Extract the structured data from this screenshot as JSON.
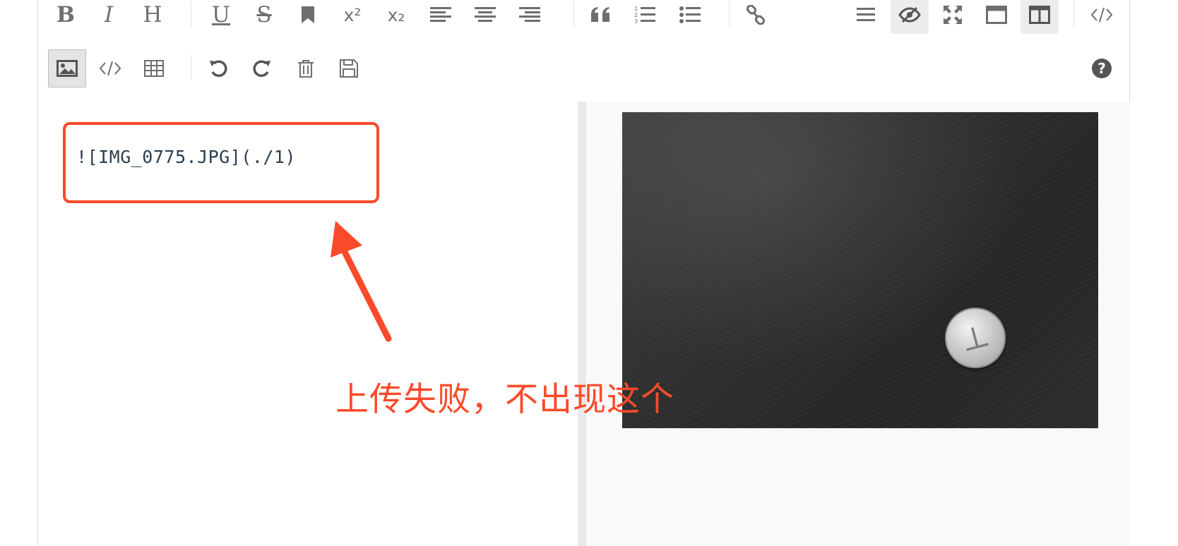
{
  "toolbar": {
    "bold": "B",
    "italic": "I",
    "heading": "H",
    "underline": "U",
    "strike": "S",
    "sup": "x²",
    "sub": "x₂"
  },
  "editor": {
    "markdown_line": "![IMG_0775.JPG](./1)"
  },
  "annotation": {
    "text": "上传失败，不出现这个",
    "color": "#fb4a2a"
  },
  "icons": [
    "bold-icon",
    "italic-icon",
    "heading-icon",
    "underline-icon",
    "strikethrough-icon",
    "bookmark-icon",
    "superscript-icon",
    "subscript-icon",
    "align-left-icon",
    "align-center-icon",
    "align-right-icon",
    "quote-icon",
    "ordered-list-icon",
    "unordered-list-icon",
    "link-icon",
    "menu-icon",
    "eye-slash-icon",
    "fullscreen-icon",
    "window-icon",
    "split-view-icon",
    "code-icon",
    "image-icon",
    "code-block-icon",
    "table-icon",
    "undo-icon",
    "redo-icon",
    "trash-icon",
    "save-icon",
    "help-icon"
  ]
}
